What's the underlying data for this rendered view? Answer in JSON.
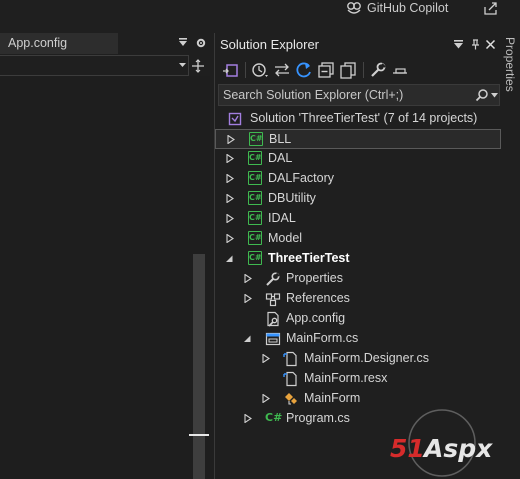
{
  "topbar": {
    "copilot_label": "GitHub Copilot"
  },
  "editor": {
    "tab_label": "App.config"
  },
  "right_strip": {
    "properties_label": "Properties"
  },
  "solution_explorer": {
    "title": "Solution Explorer",
    "search_placeholder": "Search Solution Explorer (Ctrl+;)",
    "solution_label": "Solution 'ThreeTierTest' (7 of 14 projects)",
    "items": [
      {
        "label": "BLL",
        "icon": "csharp-project-icon"
      },
      {
        "label": "DAL",
        "icon": "csharp-project-icon"
      },
      {
        "label": "DALFactory",
        "icon": "csharp-project-icon"
      },
      {
        "label": "DBUtility",
        "icon": "csharp-project-icon"
      },
      {
        "label": "IDAL",
        "icon": "csharp-project-icon"
      },
      {
        "label": "Model",
        "icon": "csharp-project-icon"
      },
      {
        "label": "ThreeTierTest",
        "icon": "csharp-project-icon"
      },
      {
        "label": "Properties",
        "icon": "wrench-icon"
      },
      {
        "label": "References",
        "icon": "references-icon"
      },
      {
        "label": "App.config",
        "icon": "config-file-icon"
      },
      {
        "label": "MainForm.cs",
        "icon": "form-icon"
      },
      {
        "label": "MainForm.Designer.cs",
        "icon": "csharp-file-icon"
      },
      {
        "label": "MainForm.resx",
        "icon": "resx-file-icon"
      },
      {
        "label": "MainForm",
        "icon": "class-icon"
      },
      {
        "label": "Program.cs",
        "icon": "csharp-file-icon"
      }
    ]
  },
  "watermark": {
    "brand": "51Aspx"
  },
  "colors": {
    "background": "#1f1f1f",
    "csharp_green": "#3fb950",
    "accent_blue": "#3794ff"
  }
}
